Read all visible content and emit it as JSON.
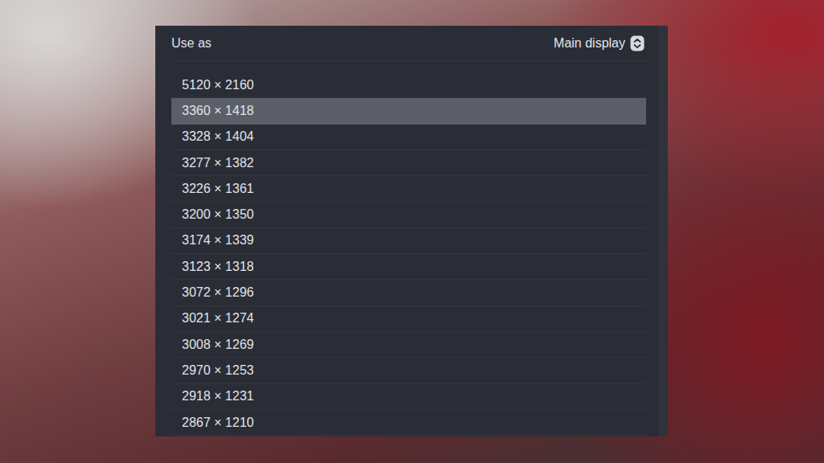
{
  "header": {
    "label": "Use as",
    "value": "Main display"
  },
  "resolutions": [
    {
      "label": "5120 × 2160",
      "selected": false
    },
    {
      "label": "3360 × 1418",
      "selected": true
    },
    {
      "label": "3328 × 1404",
      "selected": false
    },
    {
      "label": "3277 × 1382",
      "selected": false
    },
    {
      "label": "3226 × 1361",
      "selected": false
    },
    {
      "label": "3200 × 1350",
      "selected": false
    },
    {
      "label": "3174 × 1339",
      "selected": false
    },
    {
      "label": "3123 × 1318",
      "selected": false
    },
    {
      "label": "3072 × 1296",
      "selected": false
    },
    {
      "label": "3021 × 1274",
      "selected": false
    },
    {
      "label": "3008 × 1269",
      "selected": false
    },
    {
      "label": "2970 × 1253",
      "selected": false
    },
    {
      "label": "2918 × 1231",
      "selected": false
    },
    {
      "label": "2867 × 1210",
      "selected": false
    }
  ]
}
